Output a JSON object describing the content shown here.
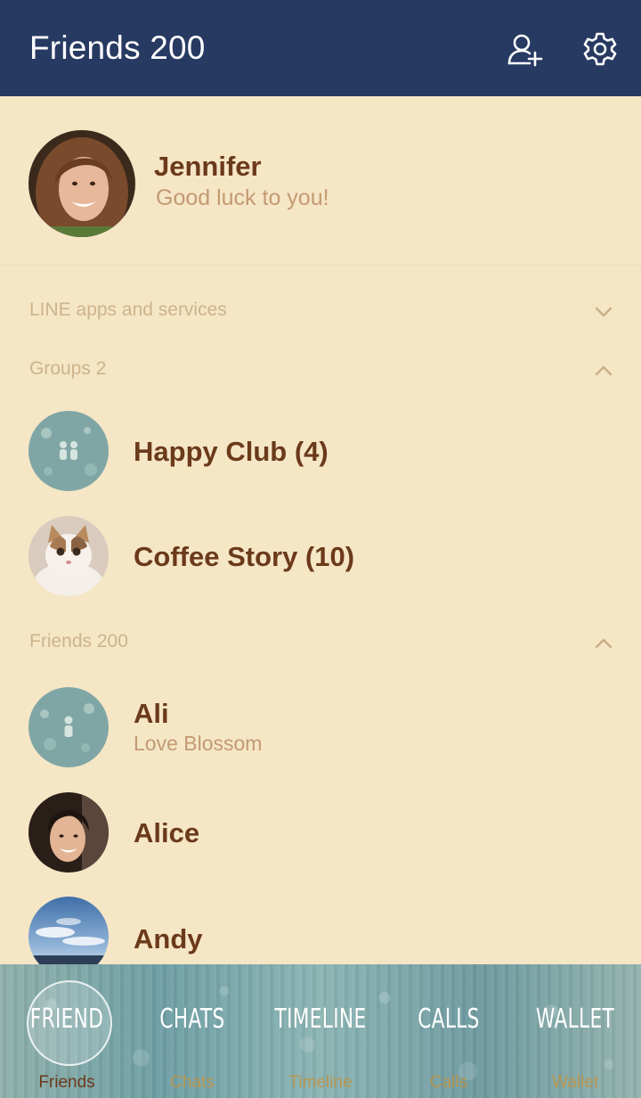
{
  "header": {
    "title": "Friends 200",
    "add_friend_icon": "add-friend-icon",
    "settings_icon": "gear-icon",
    "bg_color": "#273a62"
  },
  "profile": {
    "name": "Jennifer",
    "status": "Good luck to you!"
  },
  "sections": {
    "services": {
      "label": "LINE apps and services",
      "state": "collapsed"
    },
    "groups": {
      "label": "Groups 2",
      "state": "expanded"
    },
    "friends": {
      "label": "Friends 200",
      "state": "expanded"
    }
  },
  "groups": [
    {
      "name": "Happy Club (4)",
      "avatar": "group-default-avatar"
    },
    {
      "name": "Coffee Story (10)",
      "avatar": "cat-photo-avatar"
    }
  ],
  "friends": [
    {
      "name": "Ali",
      "status": "Love Blossom",
      "avatar": "default-avatar"
    },
    {
      "name": "Alice",
      "status": "",
      "avatar": "woman-photo-avatar"
    },
    {
      "name": "Andy",
      "status": "",
      "avatar": "sky-photo-avatar"
    }
  ],
  "tabs": [
    {
      "icon_text": "FRIEND",
      "label": "Friends",
      "active": true
    },
    {
      "icon_text": "CHATS",
      "label": "Chats",
      "active": false
    },
    {
      "icon_text": "TIMELINE",
      "label": "Timeline",
      "active": false
    },
    {
      "icon_text": "CALLS",
      "label": "Calls",
      "active": false
    },
    {
      "icon_text": "WALLET",
      "label": "Wallet",
      "active": false
    }
  ],
  "colors": {
    "background": "#f5e6c6",
    "name_text": "#6b3a1a",
    "status_text": "#c39a72",
    "section_text": "#cdb48c",
    "tab_label": "#b89650"
  }
}
